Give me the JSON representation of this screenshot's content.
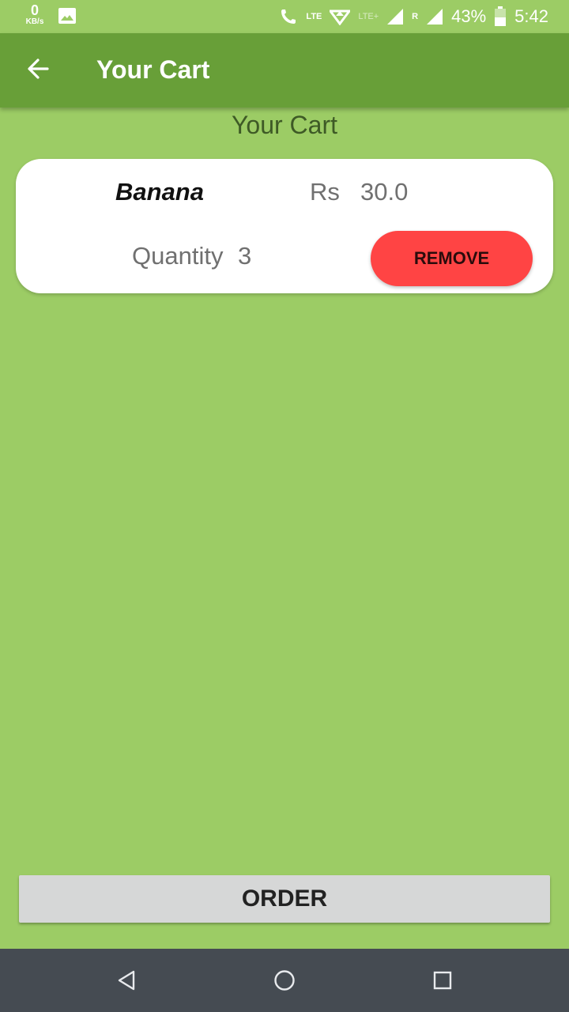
{
  "status_bar": {
    "speed_value": "0",
    "speed_unit": "KB/s",
    "lte_label": "LTE",
    "lte_plus_label": "LTE+",
    "roaming_label": "R",
    "battery": "43%",
    "time": "5:42"
  },
  "app_bar": {
    "title": "Your Cart"
  },
  "page": {
    "heading": "Your Cart"
  },
  "cart": {
    "items": [
      {
        "name": "Banana",
        "currency": "Rs",
        "price": "30.0",
        "quantity_label": "Quantity",
        "quantity": "3",
        "remove_label": "REMOVE"
      }
    ]
  },
  "order_button": {
    "label": "ORDER"
  },
  "colors": {
    "background": "#9ccc65",
    "app_bar": "#689f38",
    "remove_button": "#ff4444",
    "order_button": "#d6d7d7",
    "nav_bar": "#454b52"
  },
  "icons": {
    "back": "arrow-left-icon",
    "nav_back": "triangle-back-icon",
    "nav_home": "circle-home-icon",
    "nav_recents": "square-recents-icon"
  }
}
